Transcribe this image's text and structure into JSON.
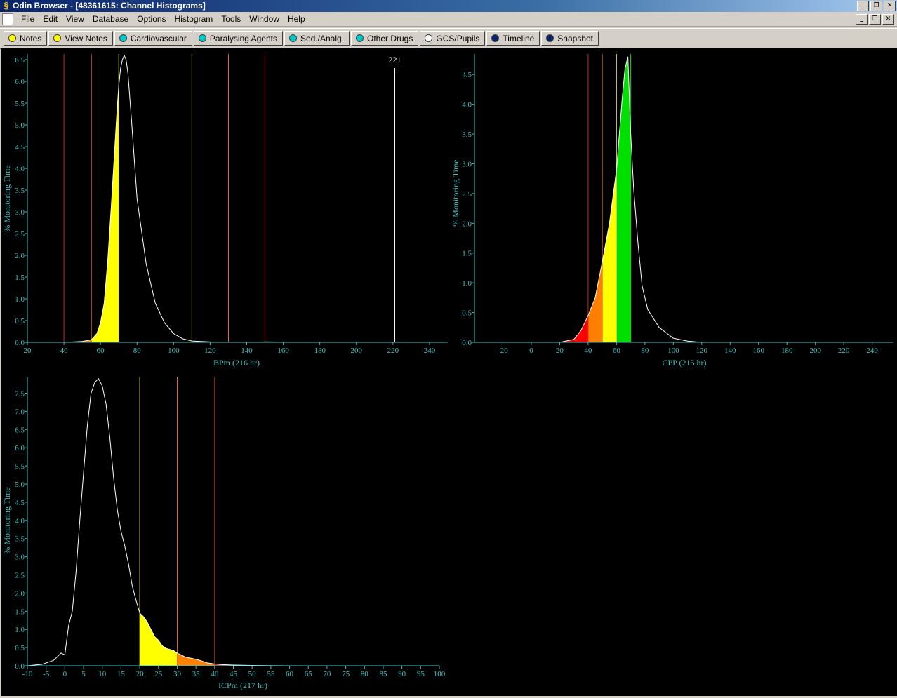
{
  "window": {
    "title": "Odin Browser - [48361615:  Channel Histograms]"
  },
  "menu": [
    "File",
    "Edit",
    "View",
    "Database",
    "Options",
    "Histogram",
    "Tools",
    "Window",
    "Help"
  ],
  "toolbar": [
    {
      "label": "Notes",
      "icon": "yellow-dot-icon",
      "color": "#ffff00"
    },
    {
      "label": "View Notes",
      "icon": "yellow-dot-icon",
      "color": "#ffff00"
    },
    {
      "label": "Cardiovascular",
      "icon": "cyan-dot-icon",
      "color": "#00c8c8"
    },
    {
      "label": "Paralysing Agents",
      "icon": "cyan-dot-icon",
      "color": "#00c8c8"
    },
    {
      "label": "Sed./Analg.",
      "icon": "cyan-dot-icon",
      "color": "#00c8c8"
    },
    {
      "label": "Other Drugs",
      "icon": "cyan-dot-icon",
      "color": "#00c8c8"
    },
    {
      "label": "GCS/Pupils",
      "icon": "white-dot-icon",
      "color": "#ffffff"
    },
    {
      "label": "Timeline",
      "icon": "navy-dot-icon",
      "color": "#0a246a"
    },
    {
      "label": "Snapshot",
      "icon": "navy-dot-icon",
      "color": "#0a246a"
    }
  ],
  "colors": {
    "axis": "#40c0c0",
    "curve": "#ffffff",
    "red": "#ff0000",
    "orange": "#ff8000",
    "yellow": "#ffff00",
    "green": "#00e000",
    "darkred_line": "#c03018",
    "orange_line": "#e07020",
    "yellow_line": "#d8d860"
  },
  "chart_data": [
    {
      "type": "area",
      "xlabel": "BPm (216 hr)",
      "ylabel": "% Monitoring Time",
      "xlim": [
        20,
        250
      ],
      "ylim": [
        0,
        6.5
      ],
      "xticks": [
        20,
        40,
        60,
        80,
        100,
        120,
        140,
        160,
        180,
        200,
        220,
        240
      ],
      "yticks": [
        "0.0",
        "0.5",
        "1.0",
        "1.5",
        "2.0",
        "2.5",
        "3.0",
        "3.5",
        "4.0",
        "4.5",
        "5.0",
        "5.5",
        "6.0",
        "6.5"
      ],
      "x": [
        20,
        40,
        50,
        55,
        58,
        60,
        62,
        64,
        66,
        68,
        69,
        70,
        71,
        72,
        73,
        74,
        75,
        77,
        80,
        85,
        90,
        95,
        100,
        105,
        110,
        120,
        130,
        150,
        180,
        220,
        250
      ],
      "y": [
        0,
        0,
        0.02,
        0.06,
        0.2,
        0.45,
        0.9,
        1.9,
        3.2,
        4.6,
        5.3,
        5.9,
        6.3,
        6.5,
        6.6,
        6.5,
        6.2,
        5.1,
        3.3,
        1.8,
        0.9,
        0.45,
        0.2,
        0.08,
        0.03,
        0.01,
        0.0,
        0.01,
        0.0,
        0.0,
        0.0
      ],
      "fills": [
        {
          "from": 20,
          "to": 40,
          "color": "red"
        },
        {
          "from": 40,
          "to": 55,
          "color": "orange"
        },
        {
          "from": 55,
          "to": 70,
          "color": "yellow"
        }
      ],
      "thresholds": [
        {
          "x": 40,
          "color": "darkred_line"
        },
        {
          "x": 55,
          "color": "orange_line"
        },
        {
          "x": 70,
          "color": "yellow_line"
        },
        {
          "x": 110,
          "color": "yellow_line"
        },
        {
          "x": 130,
          "color": "orange_line"
        },
        {
          "x": 150,
          "color": "darkred_line"
        }
      ],
      "marker": {
        "x": 221,
        "label": "221"
      }
    },
    {
      "type": "area",
      "xlabel": "CPP (215 hr)",
      "ylabel": "% Monitoring Time",
      "xlim": [
        -40,
        255
      ],
      "ylim": [
        0,
        4.75
      ],
      "xticks": [
        -20,
        0,
        20,
        40,
        60,
        80,
        100,
        120,
        140,
        160,
        180,
        200,
        220,
        240
      ],
      "yticks": [
        "0.0",
        "0.5",
        "1.0",
        "1.5",
        "2.0",
        "2.5",
        "3.0",
        "3.5",
        "4.0",
        "4.5"
      ],
      "x": [
        -40,
        20,
        30,
        35,
        40,
        45,
        50,
        55,
        60,
        62,
        64,
        66,
        68,
        70,
        72,
        75,
        78,
        82,
        90,
        100,
        110,
        120,
        255
      ],
      "y": [
        0,
        0,
        0.05,
        0.2,
        0.45,
        0.75,
        1.35,
        2.0,
        2.9,
        3.5,
        4.1,
        4.6,
        4.8,
        3.5,
        2.6,
        1.7,
        0.95,
        0.55,
        0.25,
        0.07,
        0.02,
        0.0,
        0.0
      ],
      "fills": [
        {
          "from": -40,
          "to": 40,
          "color": "red"
        },
        {
          "from": 40,
          "to": 50,
          "color": "orange"
        },
        {
          "from": 50,
          "to": 60,
          "color": "yellow"
        },
        {
          "from": 60,
          "to": 70,
          "color": "green"
        }
      ],
      "thresholds": [
        {
          "x": 40,
          "color": "darkred_line"
        },
        {
          "x": 50,
          "color": "orange_line"
        },
        {
          "x": 60,
          "color": "yellow_line"
        },
        {
          "x": 70,
          "color": "green"
        }
      ]
    },
    {
      "type": "area",
      "xlabel": "ICPm (217 hr)",
      "ylabel": "% Monitoring Time",
      "xlim": [
        -10,
        100
      ],
      "ylim": [
        0,
        7.8
      ],
      "xticks": [
        -10,
        -5,
        0,
        5,
        10,
        15,
        20,
        25,
        30,
        35,
        40,
        45,
        50,
        55,
        60,
        65,
        70,
        75,
        80,
        85,
        90,
        95,
        100
      ],
      "yticks": [
        "0.0",
        "0.5",
        "1.0",
        "1.5",
        "2.0",
        "2.5",
        "3.0",
        "3.5",
        "4.0",
        "4.5",
        "5.0",
        "5.5",
        "6.0",
        "6.5",
        "7.0",
        "7.5"
      ],
      "x": [
        -10,
        -6,
        -3,
        -1,
        0,
        1,
        2,
        3,
        4,
        5,
        6,
        7,
        8,
        9,
        10,
        11,
        12,
        13,
        14,
        15,
        16,
        17,
        18,
        19,
        20,
        21,
        22,
        23,
        24,
        25,
        26,
        27,
        28,
        29,
        30,
        31,
        32,
        33,
        34,
        35,
        36,
        38,
        40,
        42,
        45,
        50,
        60,
        100
      ],
      "y": [
        0,
        0.04,
        0.15,
        0.35,
        0.3,
        1.1,
        1.5,
        2.6,
        4.0,
        5.3,
        6.6,
        7.5,
        7.8,
        7.9,
        7.7,
        7.2,
        6.3,
        5.2,
        4.3,
        3.7,
        3.3,
        2.8,
        2.2,
        1.8,
        1.45,
        1.35,
        1.2,
        1.0,
        0.8,
        0.7,
        0.55,
        0.48,
        0.45,
        0.42,
        0.35,
        0.3,
        0.25,
        0.22,
        0.2,
        0.18,
        0.15,
        0.08,
        0.05,
        0.03,
        0.02,
        0.01,
        0.0,
        0.0
      ],
      "fills": [
        {
          "from": 20,
          "to": 30,
          "color": "yellow"
        },
        {
          "from": 30,
          "to": 40,
          "color": "orange"
        },
        {
          "from": 40,
          "to": 100,
          "color": "red"
        }
      ],
      "thresholds": [
        {
          "x": 20,
          "color": "yellow_line"
        },
        {
          "x": 30,
          "color": "orange_line"
        },
        {
          "x": 40,
          "color": "darkred_line"
        }
      ]
    }
  ]
}
